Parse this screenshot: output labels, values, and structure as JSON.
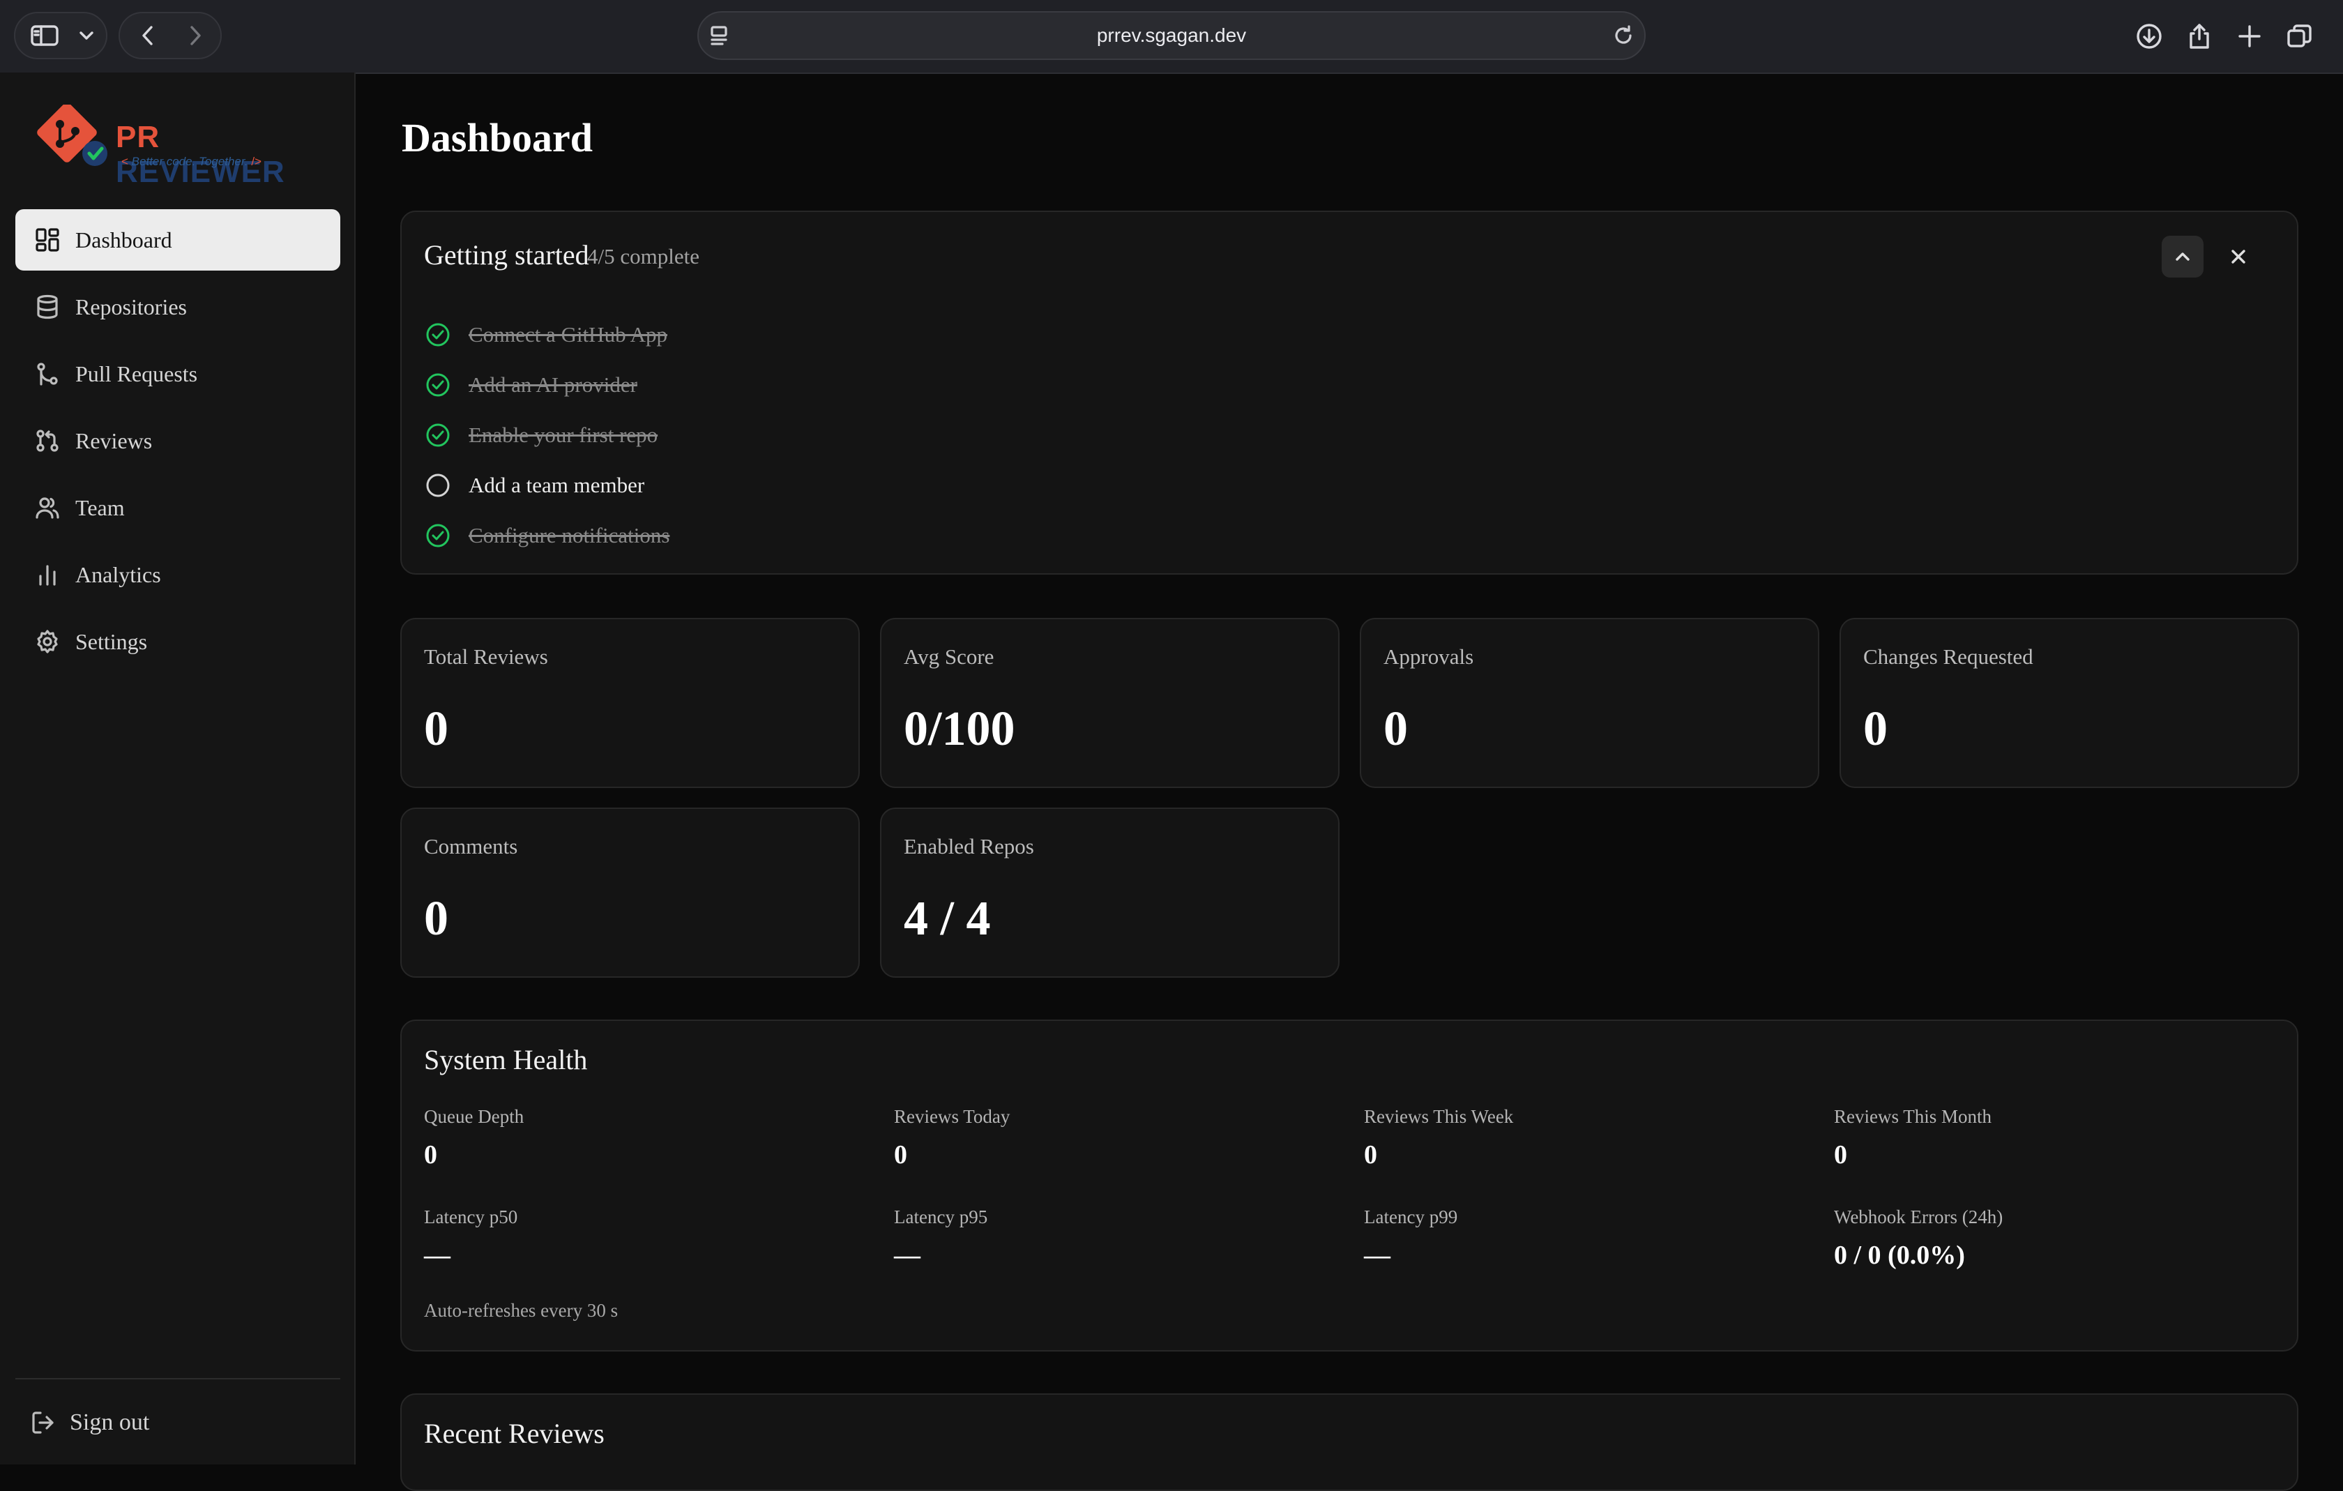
{
  "browser": {
    "url": "prrev.sgagan.dev"
  },
  "brand": {
    "name_prefix": "PR",
    "name_suffix": "REVIEWER",
    "tagline_open": "<",
    "tagline": "Better code. Together.",
    "tagline_close": "/>",
    "colors": {
      "primary": "#e5533b",
      "secondary": "#1f3d6e",
      "check": "#22c55e"
    }
  },
  "sidebar": {
    "items": [
      {
        "label": "Dashboard",
        "icon": "dashboard-grid-icon",
        "active": true
      },
      {
        "label": "Repositories",
        "icon": "database-icon",
        "active": false
      },
      {
        "label": "Pull Requests",
        "icon": "git-branch-icon",
        "active": false
      },
      {
        "label": "Reviews",
        "icon": "git-pull-request-icon",
        "active": false
      },
      {
        "label": "Team",
        "icon": "users-icon",
        "active": false
      },
      {
        "label": "Analytics",
        "icon": "bar-chart-icon",
        "active": false
      },
      {
        "label": "Settings",
        "icon": "gear-icon",
        "active": false
      }
    ],
    "signout_label": "Sign out"
  },
  "main": {
    "title": "Dashboard",
    "getting_started": {
      "title": "Getting started",
      "progress": "4/5 complete",
      "tasks": [
        {
          "label": "Connect a GitHub App",
          "done": true
        },
        {
          "label": "Add an AI provider",
          "done": true
        },
        {
          "label": "Enable your first repo",
          "done": true
        },
        {
          "label": "Add a team member",
          "done": false
        },
        {
          "label": "Configure notifications",
          "done": true
        }
      ]
    },
    "stats": [
      {
        "label": "Total Reviews",
        "value": "0"
      },
      {
        "label": "Avg Score",
        "value": "0/100"
      },
      {
        "label": "Approvals",
        "value": "0"
      },
      {
        "label": "Changes Requested",
        "value": "0"
      },
      {
        "label": "Comments",
        "value": "0"
      },
      {
        "label": "Enabled Repos",
        "value": "4 / 4"
      }
    ],
    "system_health": {
      "title": "System Health",
      "metrics": [
        {
          "label": "Queue Depth",
          "value": "0"
        },
        {
          "label": "Reviews Today",
          "value": "0"
        },
        {
          "label": "Reviews This Week",
          "value": "0"
        },
        {
          "label": "Reviews This Month",
          "value": "0"
        },
        {
          "label": "Latency p50",
          "value": "—"
        },
        {
          "label": "Latency p95",
          "value": "—"
        },
        {
          "label": "Latency p99",
          "value": "—"
        },
        {
          "label": "Webhook Errors (24h)",
          "value": "0 / 0 (0.0%)"
        }
      ],
      "note": "Auto-refreshes every 30 s"
    },
    "recent_reviews": {
      "title": "Recent Reviews"
    }
  }
}
